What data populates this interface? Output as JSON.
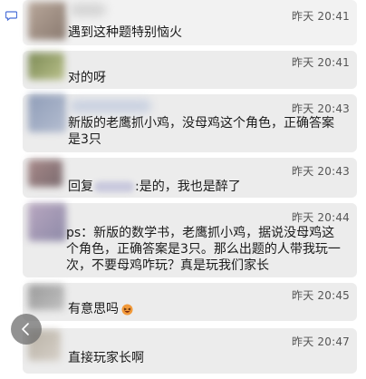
{
  "comments": [
    {
      "time": "昨天 20:41",
      "text": "遇到这种题特别恼火"
    },
    {
      "time": "昨天 20:41",
      "text": "对的呀"
    },
    {
      "time": "昨天 20:43",
      "text": "新版的老鹰抓小鸡，没母鸡这个角色，正确答案是3只"
    },
    {
      "time": "昨天 20:43",
      "reply_prefix": "回复",
      "reply_suffix": ":是的，我也是醉了"
    },
    {
      "time": "昨天 20:44",
      "text": "ps：新版的数学书，老鹰抓小鸡，据说没母鸡这个角色，正确答案是3只。那么出题的人带我玩一次，不要母鸡咋玩？真是玩我们家长"
    },
    {
      "time": "昨天 20:45",
      "text": "有意思吗"
    },
    {
      "time": "昨天 20:47",
      "text": "直接玩家长啊"
    }
  ],
  "icons": {
    "comment": "speech-bubble-icon",
    "back": "chevron-left-icon",
    "emoji": "laughing-face-icon"
  },
  "colors": {
    "card_bg": "#ececec",
    "time_text": "#555555",
    "icon_blue": "#4a6fd8"
  }
}
